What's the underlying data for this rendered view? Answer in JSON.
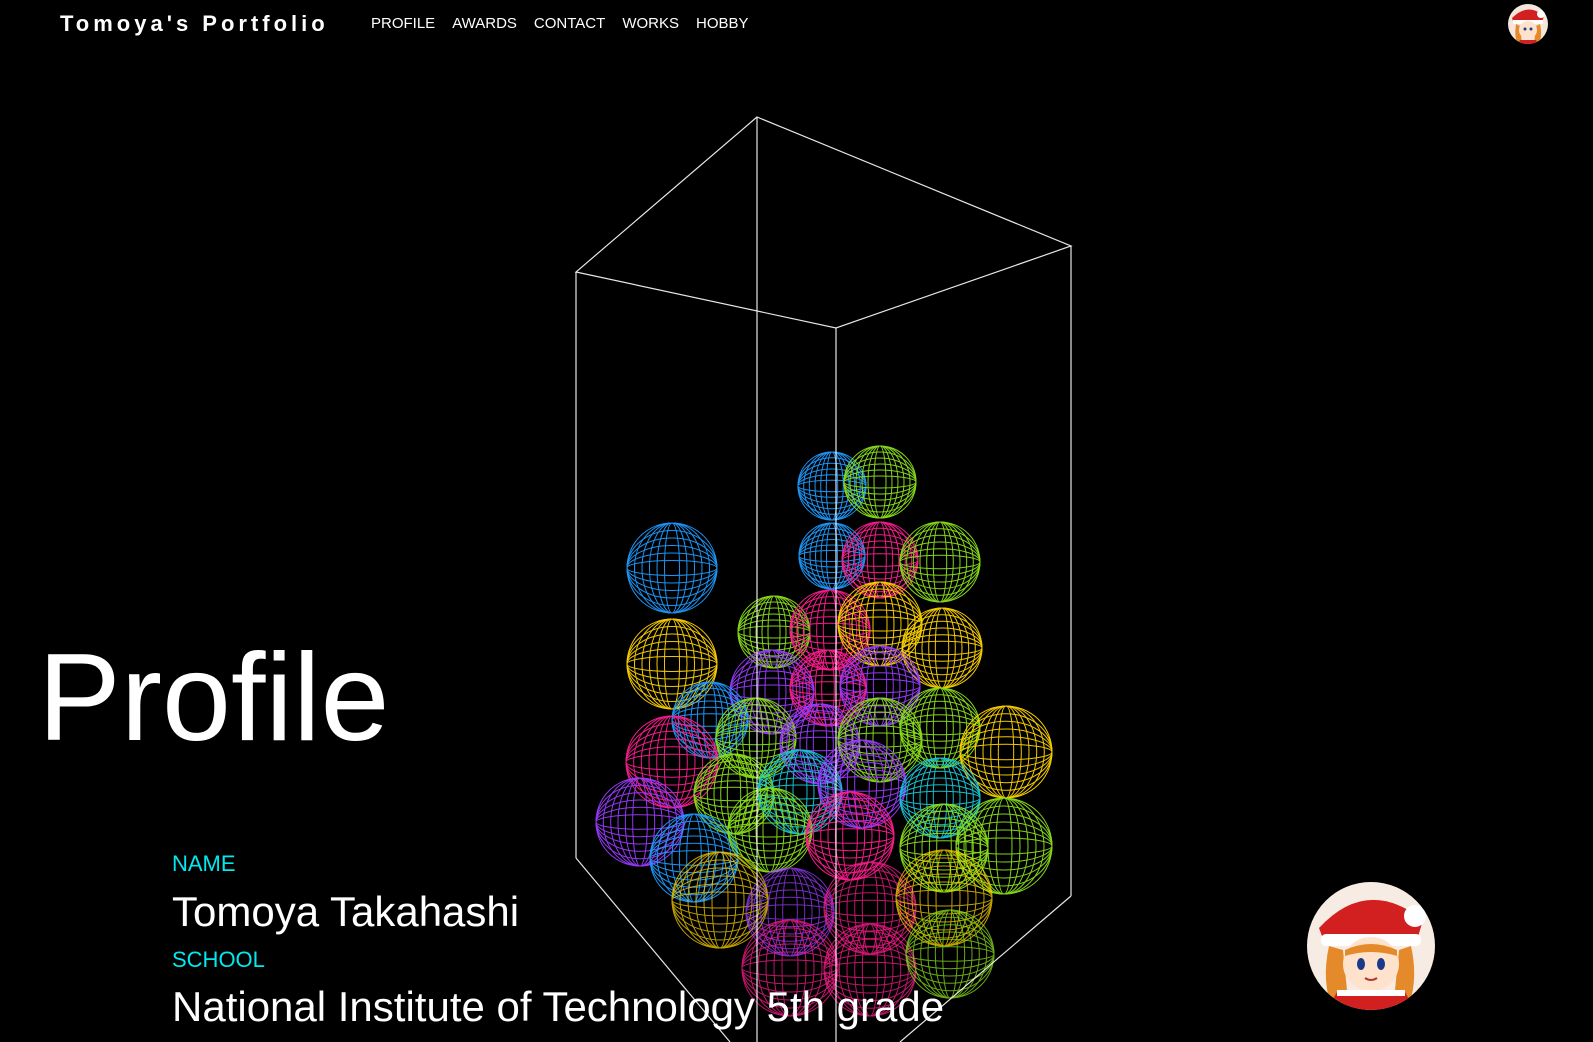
{
  "header": {
    "brand": "Tomoya's Portfolio",
    "nav": [
      "PROFILE",
      "AWARDS",
      "CONTACT",
      "WORKS",
      "HOBBY"
    ]
  },
  "main": {
    "section_title": "Profile",
    "profile": {
      "name_label": "NAME",
      "name_value": "Tomoya Takahashi",
      "school_label": "SCHOOL",
      "school_value": "National Institute of Technology 5th grade"
    }
  },
  "colors": {
    "background": "#000000",
    "text": "#ffffff",
    "accent_label": "#00e8f0",
    "ball_colors": [
      "#1e9bff",
      "#8be01c",
      "#ff1e90",
      "#ffd400",
      "#9a3cff",
      "#17c8d8"
    ]
  },
  "icons": {
    "avatar_small": "avatar-icon",
    "avatar_large": "avatar-icon"
  }
}
